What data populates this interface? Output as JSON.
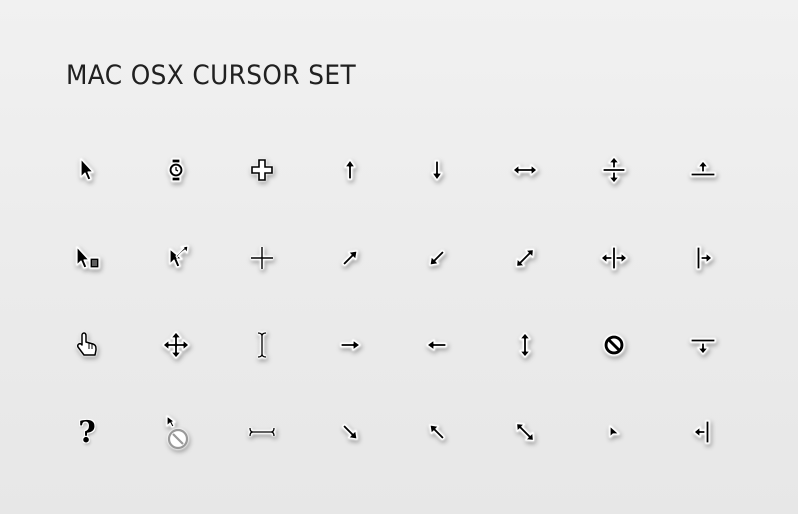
{
  "title": "MAC OSX CURSOR SET",
  "cursors": [
    {
      "icon": "arrow-pointer-icon"
    },
    {
      "icon": "watch-busy-icon"
    },
    {
      "icon": "thick-crosshair-icon"
    },
    {
      "icon": "arrow-up-icon"
    },
    {
      "icon": "arrow-down-icon"
    },
    {
      "icon": "resize-left-right-icon"
    },
    {
      "icon": "resize-up-down-split-icon"
    },
    {
      "icon": "resize-up-edge-icon"
    },
    {
      "icon": "arrow-context-menu-icon"
    },
    {
      "icon": "alias-arrow-icon"
    },
    {
      "icon": "thin-crosshair-icon"
    },
    {
      "icon": "arrow-northeast-icon"
    },
    {
      "icon": "arrow-southwest-icon"
    },
    {
      "icon": "resize-northeast-southwest-icon"
    },
    {
      "icon": "resize-left-right-split-icon"
    },
    {
      "icon": "resize-right-edge-icon"
    },
    {
      "icon": "pointing-hand-icon"
    },
    {
      "icon": "move-icon"
    },
    {
      "icon": "i-beam-icon"
    },
    {
      "icon": "arrow-right-icon"
    },
    {
      "icon": "arrow-left-icon"
    },
    {
      "icon": "resize-up-down-icon"
    },
    {
      "icon": "not-allowed-icon"
    },
    {
      "icon": "resize-down-edge-icon"
    },
    {
      "icon": "help-icon",
      "label": "?"
    },
    {
      "icon": "arrow-not-allowed-icon"
    },
    {
      "icon": "vertical-i-beam-icon"
    },
    {
      "icon": "arrow-southeast-icon"
    },
    {
      "icon": "arrow-northwest-icon"
    },
    {
      "icon": "resize-northwest-southeast-icon"
    },
    {
      "icon": "small-arrow-icon"
    },
    {
      "icon": "resize-left-edge-icon"
    }
  ]
}
